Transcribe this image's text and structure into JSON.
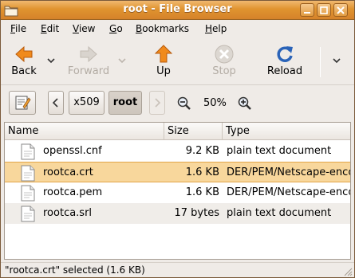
{
  "window": {
    "title": "root - File Browser",
    "accent": "#e0942f"
  },
  "menubar": {
    "items": [
      {
        "label": "File",
        "mnemonic": "F"
      },
      {
        "label": "Edit",
        "mnemonic": "E"
      },
      {
        "label": "View",
        "mnemonic": "V"
      },
      {
        "label": "Go",
        "mnemonic": "G"
      },
      {
        "label": "Bookmarks",
        "mnemonic": "B"
      },
      {
        "label": "Help",
        "mnemonic": "H"
      }
    ]
  },
  "toolbar": {
    "back_label": "Back",
    "forward_label": "Forward",
    "up_label": "Up",
    "stop_label": "Stop",
    "reload_label": "Reload"
  },
  "location": {
    "crumbs": [
      "x509",
      "root"
    ],
    "active_crumb": "root",
    "zoom": "50%"
  },
  "list": {
    "columns": [
      "Name",
      "Size",
      "Type"
    ],
    "rows": [
      {
        "name": "openssl.cnf",
        "size": "9.2 KB",
        "type": "plain text document",
        "selected": false
      },
      {
        "name": "rootca.crt",
        "size": "1.6 KB",
        "type": "DER/PEM/Netscape-enco",
        "selected": true
      },
      {
        "name": "rootca.pem",
        "size": "1.6 KB",
        "type": "DER/PEM/Netscape-enco",
        "selected": false
      },
      {
        "name": "rootca.srl",
        "size": "17 bytes",
        "type": "plain text document",
        "selected": false
      }
    ]
  },
  "statusbar": {
    "text": "\"rootca.crt\" selected (1.6 KB)"
  }
}
